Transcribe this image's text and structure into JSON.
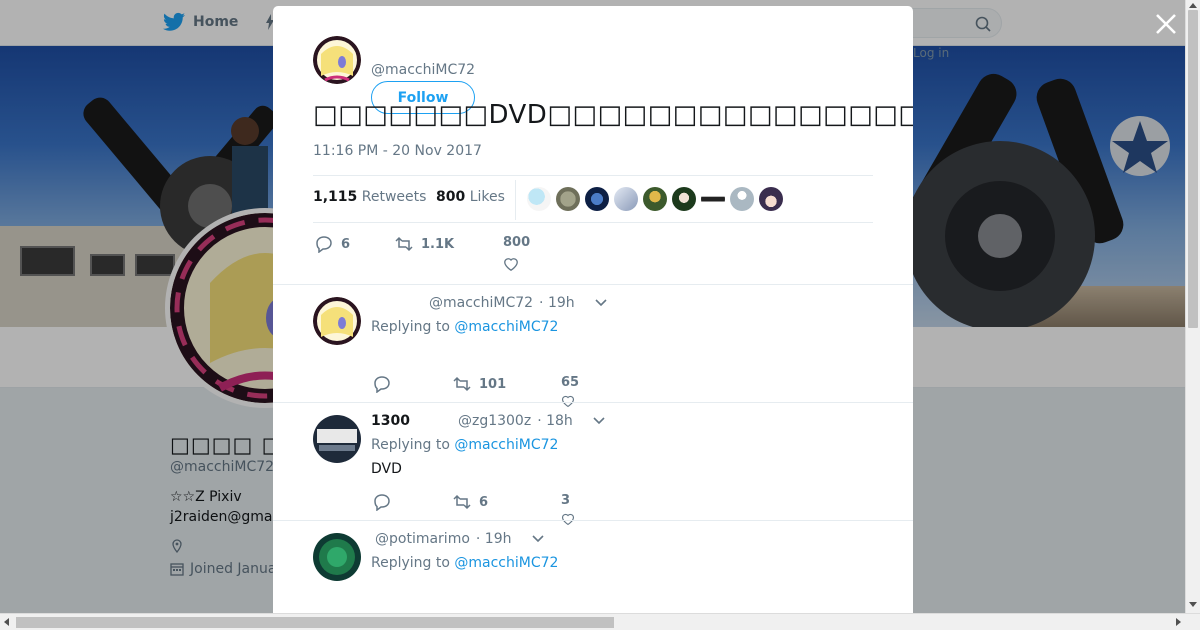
{
  "nav": {
    "home_label": "Home",
    "login_label": "Log in"
  },
  "profile": {
    "display_name": "□□□□ □□□□",
    "handle": "@macchiMC72",
    "bio_line1": "☆☆Z Pixiv",
    "bio_line2": "j2raiden@gma",
    "joined": "Joined Janua"
  },
  "modal": {
    "author_handle": "@macchiMC72",
    "follow_label": "Follow",
    "tweet_text": "□□□□□□□DVD□□□□□□□□□□□□□□□□□□□□□□□□□□□□□□□□□□□□□",
    "timestamp": "11:16 PM - 20 Nov 2017",
    "retweets_count": "1,115",
    "retweets_label": "Retweets",
    "likes_count": "800",
    "likes_label": "Likes",
    "actions": {
      "replies": "6",
      "retweets": "1.1K",
      "likes": "800"
    }
  },
  "replies": [
    {
      "name": "",
      "handle": "@macchiMC72",
      "time": "· 19h",
      "replying_prefix": "Replying to",
      "replying_to": "@macchiMC72",
      "text": "",
      "reply_count": "",
      "retweet_count": "101",
      "like_count": "65"
    },
    {
      "name": "1300",
      "handle": "@zg1300z",
      "time": "· 18h",
      "replying_prefix": "Replying to",
      "replying_to": "@macchiMC72",
      "text": "DVD",
      "reply_count": "",
      "retweet_count": "6",
      "like_count": "3"
    },
    {
      "name": "",
      "handle": "@potimarimo",
      "time": "· 19h",
      "replying_prefix": "Replying to",
      "replying_to": "@macchiMC72",
      "text": "",
      "reply_count": "",
      "retweet_count": "",
      "like_count": ""
    }
  ],
  "colors": {
    "accent": "#1da1f2",
    "link": "#1b95e0",
    "muted": "#657786",
    "retweet_green": "#17bf63"
  },
  "icons": [
    "twitter-bird-icon",
    "search-icon",
    "close-icon",
    "reply-icon",
    "retweet-icon",
    "heart-icon",
    "chevron-down-icon",
    "location-icon",
    "calendar-icon"
  ]
}
